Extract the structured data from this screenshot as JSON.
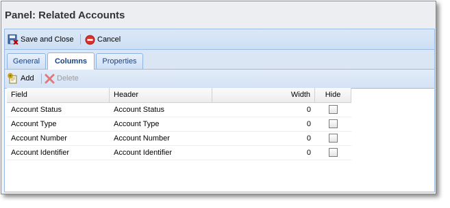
{
  "panel": {
    "title": "Panel: Related Accounts"
  },
  "toolbar": {
    "save_close_label": "Save and Close",
    "cancel_label": "Cancel"
  },
  "tabs": [
    {
      "label": "General",
      "active": false
    },
    {
      "label": "Columns",
      "active": true
    },
    {
      "label": "Properties",
      "active": false
    }
  ],
  "grid_toolbar": {
    "add_label": "Add",
    "delete_label": "Delete"
  },
  "grid": {
    "headers": {
      "field": "Field",
      "header": "Header",
      "width": "Width",
      "hide": "Hide"
    },
    "rows": [
      {
        "field": "Account Status",
        "header": "Account Status",
        "width": "0",
        "hide": false
      },
      {
        "field": "Account Type",
        "header": "Account Type",
        "width": "0",
        "hide": false
      },
      {
        "field": "Account Number",
        "header": "Account Number",
        "width": "0",
        "hide": false
      },
      {
        "field": "Account Identifier",
        "header": "Account Identifier",
        "width": "0",
        "hide": false
      }
    ]
  },
  "colors": {
    "accent": "#15428b",
    "toolbar_bg": "#cddff4",
    "disabled_text": "#9a9a9a"
  },
  "icons": {
    "save_close": "save-close-icon",
    "cancel": "cancel-icon",
    "add": "add-icon",
    "delete": "delete-icon"
  }
}
